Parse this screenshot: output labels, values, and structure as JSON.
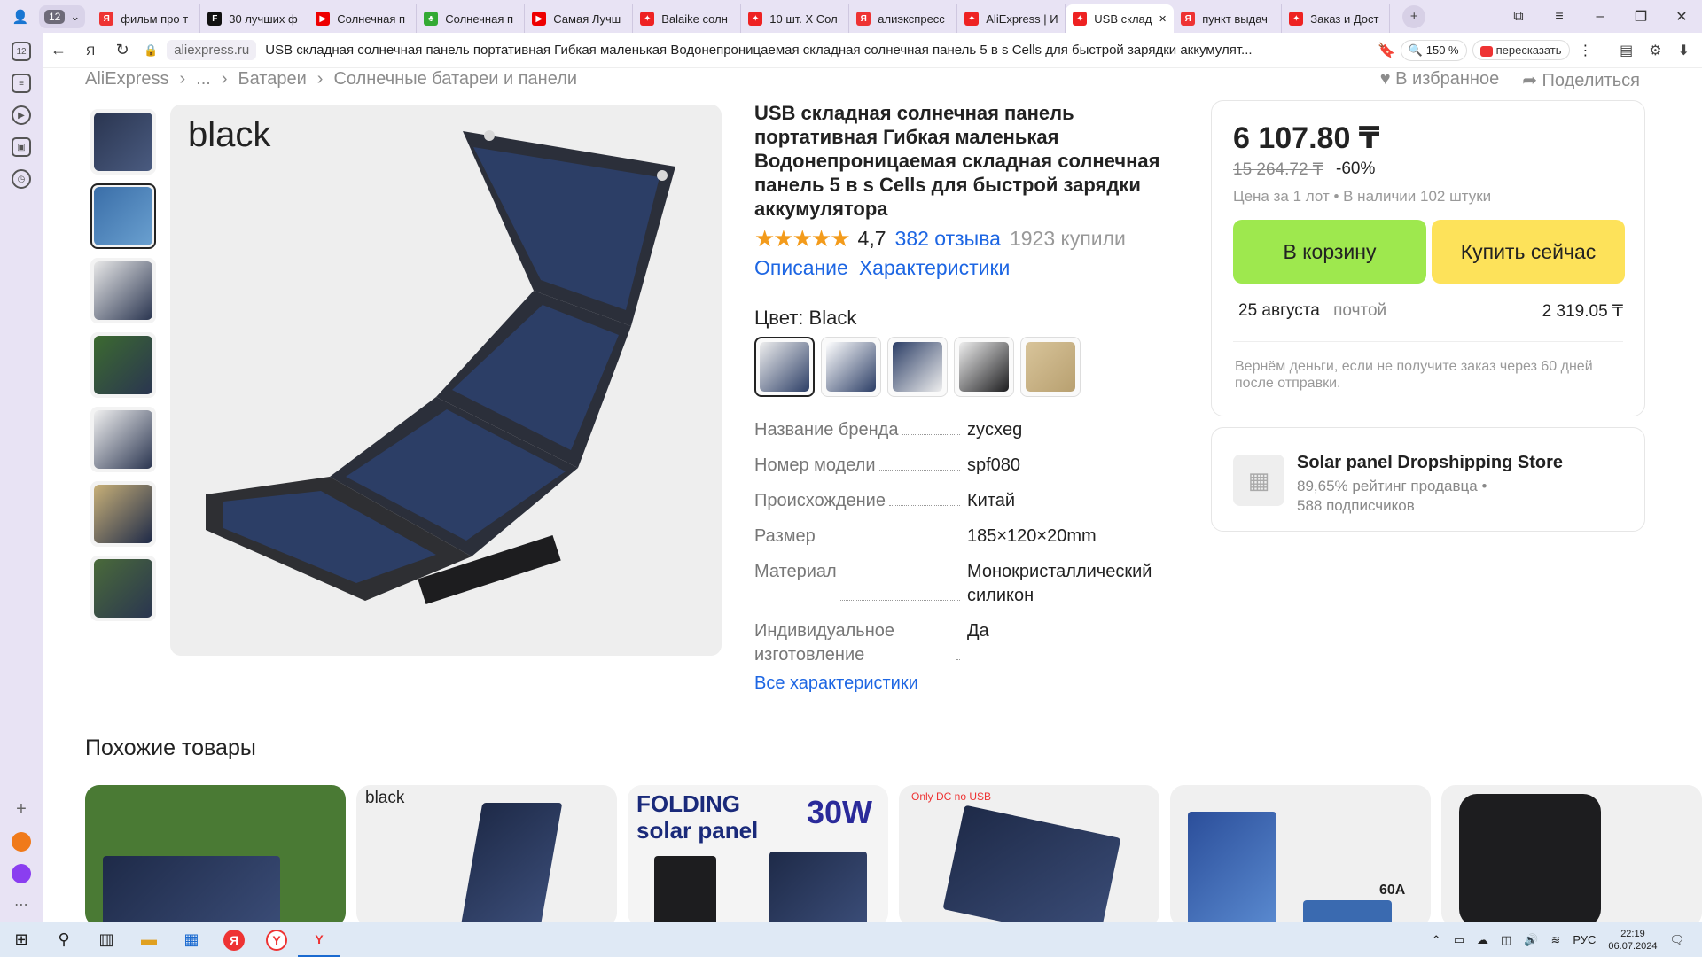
{
  "browser": {
    "tab_count": "12",
    "tabs": [
      {
        "title": "фильм про т",
        "color": "#e33",
        "glyph": "Я"
      },
      {
        "title": "30 лучших ф",
        "color": "#111",
        "glyph": "F"
      },
      {
        "title": "Солнечная п",
        "color": "#e00",
        "glyph": "▶"
      },
      {
        "title": "Солнечная п",
        "color": "#3a3",
        "glyph": "♣"
      },
      {
        "title": "Самая Лучш",
        "color": "#e00",
        "glyph": "▶"
      },
      {
        "title": "Balaike солн",
        "color": "#e22",
        "glyph": "✦"
      },
      {
        "title": "10 шт. Х Сол",
        "color": "#e22",
        "glyph": "✦"
      },
      {
        "title": "алиэкспресс",
        "color": "#e33",
        "glyph": "Я"
      },
      {
        "title": "AliExpress | И",
        "color": "#e22",
        "glyph": "✦"
      },
      {
        "title": "USB склад",
        "color": "#e22",
        "glyph": "✦",
        "active": true
      },
      {
        "title": "пункт выдач",
        "color": "#e33",
        "glyph": "Я"
      },
      {
        "title": "Заказ и Дост",
        "color": "#e22",
        "glyph": "✦"
      }
    ],
    "domain": "aliexpress.ru",
    "page_title": "USB складная солнечная панель портативная Гибкая маленькая Водонепроницаемая складная солнечная панель 5 в s Cells для быстрой зарядки аккумулят...",
    "zoom": "150 %",
    "retell": "пересказать"
  },
  "breadcrumbs": [
    "AliExpress",
    "...",
    "Батареи",
    "Солнечные батареи и панели"
  ],
  "favorite_label": "В избранное",
  "share_label": "Поделиться",
  "main_image_label": "black",
  "product": {
    "title": "USB складная солнечная панель портативная Гибкая маленькая Водонепроницаемая складная солнечная панель 5 в s Cells для быстрой зарядки аккумулятора",
    "stars": "★★★★★",
    "rating": "4,7",
    "reviews": "382 отзыва",
    "bought": "1923 купили",
    "description_link": "Описание",
    "specs_link": "Характеристики",
    "color_label": "Цвет: Black",
    "specs": [
      {
        "key": "Название бренда",
        "value": "zycxeg"
      },
      {
        "key": "Номер модели",
        "value": "spf080"
      },
      {
        "key": "Происхождение",
        "value": "Китай"
      },
      {
        "key": "Размер",
        "value": "185×120×20mm"
      },
      {
        "key": "Материал",
        "value": "Монокристаллический силикон"
      },
      {
        "key": "Индивидуальное изготовление",
        "value": "Да"
      }
    ],
    "all_specs": "Все характеристики"
  },
  "buy": {
    "price": "6 107.80 ₸",
    "old_price": "15 264.72 ₸",
    "discount": "-60%",
    "lot_info": "Цена за 1 лот • В наличии 102 штуки",
    "cart_button": "В корзину",
    "buy_button": "Купить сейчас",
    "delivery_date": "25 августа",
    "delivery_method": "почтой",
    "delivery_cost": "2 319.05 ₸",
    "refund": "Вернём деньги, если не получите заказ через 60 дней после отправки."
  },
  "store": {
    "name": "Solar panel Dropshipping Store",
    "rating": "89,65% рейтинг продавца •",
    "subscribers": "588 подписчиков"
  },
  "similar": {
    "title": "Похожие товары",
    "cards": [
      {
        "text": ""
      },
      {
        "text": "black"
      },
      {
        "text": "FOLDING solar panel",
        "watt": "30W"
      },
      {
        "text": "Only  DC no USB"
      },
      {
        "text": "60A"
      },
      {
        "text": ""
      }
    ]
  },
  "taskbar": {
    "lang": "РУС",
    "time": "22:19",
    "date": "06.07.2024"
  }
}
